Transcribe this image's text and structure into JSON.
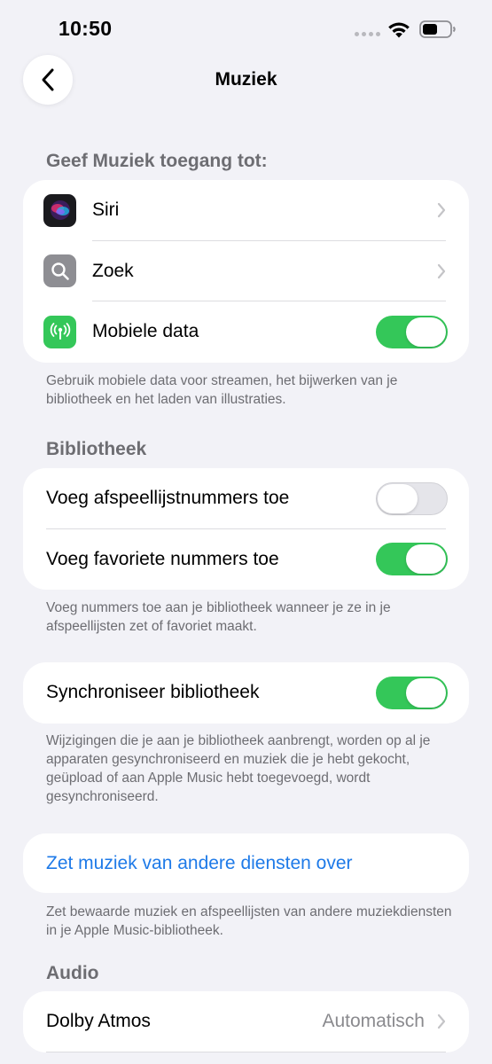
{
  "status": {
    "time": "10:50"
  },
  "nav": {
    "title": "Muziek"
  },
  "access": {
    "header": "Geef Muziek toegang tot:",
    "items": [
      {
        "label": "Siri",
        "icon": "siri-icon"
      },
      {
        "label": "Zoek",
        "icon": "search-icon"
      },
      {
        "label": "Mobiele data",
        "icon": "cellular-icon",
        "toggle": true
      }
    ],
    "footer": "Gebruik mobiele data voor streamen, het bijwerken van je bibliotheek en het laden van illustraties."
  },
  "library": {
    "header": "Bibliotheek",
    "items": [
      {
        "label": "Voeg afspeellijstnummers toe",
        "toggle": false
      },
      {
        "label": "Voeg favoriete nummers toe",
        "toggle": true
      }
    ],
    "footer": "Voeg nummers toe aan je bibliotheek wanneer je ze in je afspeellijsten zet of favoriet maakt."
  },
  "sync": {
    "label": "Synchroniseer bibliotheek",
    "toggle": true,
    "footer": "Wijzigingen die je aan je bibliotheek aanbrengt, worden op al je apparaten gesynchroniseerd en muziek die je hebt gekocht, geüpload of aan Apple Music hebt toegevoegd, wordt gesynchroniseerd."
  },
  "transfer": {
    "label": "Zet muziek van andere diensten over",
    "footer": "Zet bewaarde muziek en afspeellijsten van andere muziekdiensten in je Apple Music-bibliotheek."
  },
  "audio": {
    "header": "Audio",
    "items": [
      {
        "label": "Dolby Atmos",
        "value": "Automatisch"
      }
    ]
  },
  "colors": {
    "accent": "#1e7ae8",
    "toggle_on": "#34c759",
    "background": "#f2f2f7"
  }
}
